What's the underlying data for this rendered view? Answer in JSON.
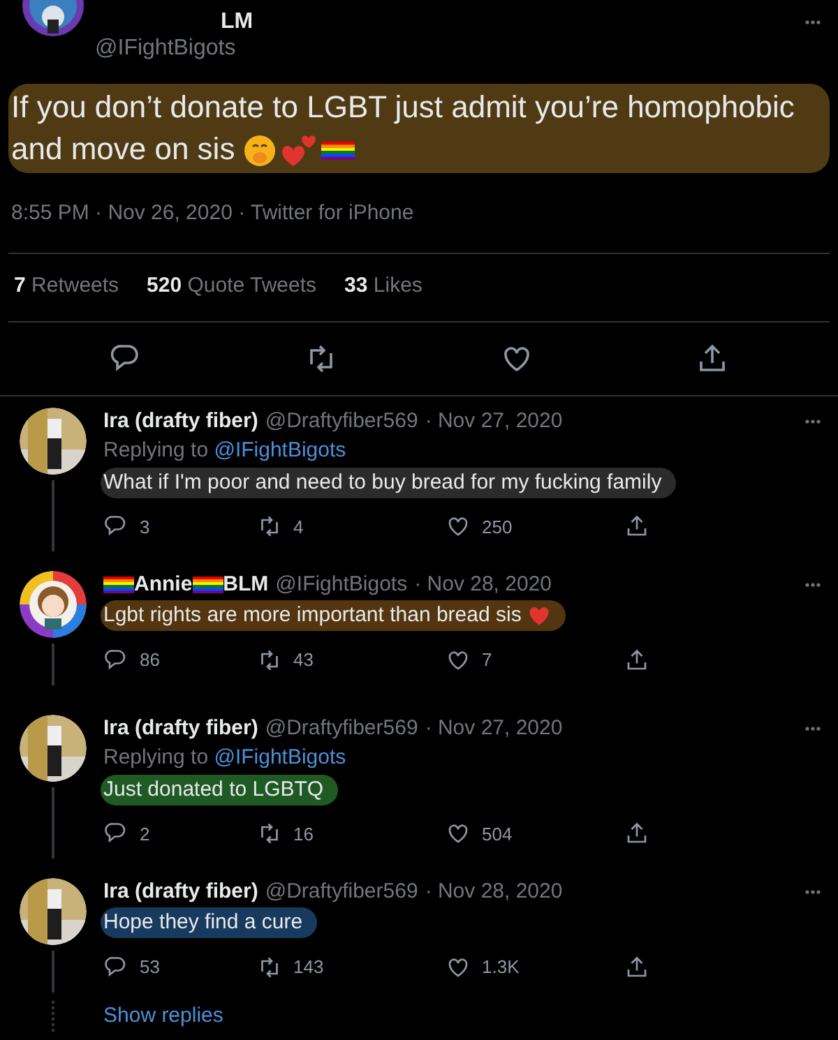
{
  "main_tweet": {
    "name_fragment": "LM",
    "handle": "@IFightBigots",
    "text": "If you don’t donate to LGBT just admit you’re homophobic and move on sis",
    "color": "#4f3a14",
    "meta": "8:55 PM · Nov 26, 2020 · Twitter for iPhone",
    "stats": [
      {
        "count": "7",
        "label": "Retweets"
      },
      {
        "count": "520",
        "label": "Quote Tweets"
      },
      {
        "count": "33",
        "label": "Likes"
      }
    ]
  },
  "replies": [
    {
      "name": [
        {
          "kind": "text",
          "text": "Ira (drafty fiber)"
        }
      ],
      "handle": "@Draftyfiber569",
      "date": "· Nov 27, 2020",
      "replying_to": {
        "prefix": "Replying to",
        "handle": "@IFightBigots"
      },
      "text": "What if I'm poor and need to buy bread for my fucking family",
      "color": "#2b2b2b",
      "heart": false,
      "replies": "3",
      "retweets": "4",
      "likes": "250"
    },
    {
      "avatar": {
        "kind": "cartoon"
      },
      "name": [
        {
          "kind": "flag"
        },
        {
          "kind": "text",
          "text": "Annie"
        },
        {
          "kind": "flag"
        },
        {
          "kind": "text",
          "text": "BLM"
        }
      ],
      "handle": "@IFightBigots",
      "date": "· Nov 28, 2020",
      "text": "Lgbt rights are more important than bread sis",
      "color": "#53360f",
      "heart": true,
      "replies": "86",
      "retweets": "43",
      "likes": "7"
    },
    {
      "name": [
        {
          "kind": "text",
          "text": "Ira (drafty fiber)"
        }
      ],
      "handle": "@Draftyfiber569",
      "date": "· Nov 27, 2020",
      "replying_to": {
        "prefix": "Replying to",
        "handle": "@IFightBigots"
      },
      "text": "Just donated to LGBTQ",
      "color": "#1f5a24",
      "heart": false,
      "replies": "2",
      "retweets": "16",
      "likes": "504"
    },
    {
      "name": [
        {
          "kind": "text",
          "text": "Ira (drafty fiber)"
        }
      ],
      "handle": "@Draftyfiber569",
      "date": "· Nov 28, 2020",
      "text": "Hope they find a cure",
      "color": "#173a5e",
      "heart": false,
      "replies": "53",
      "retweets": "143",
      "likes": "1.3K"
    }
  ],
  "show_replies": "Show replies"
}
